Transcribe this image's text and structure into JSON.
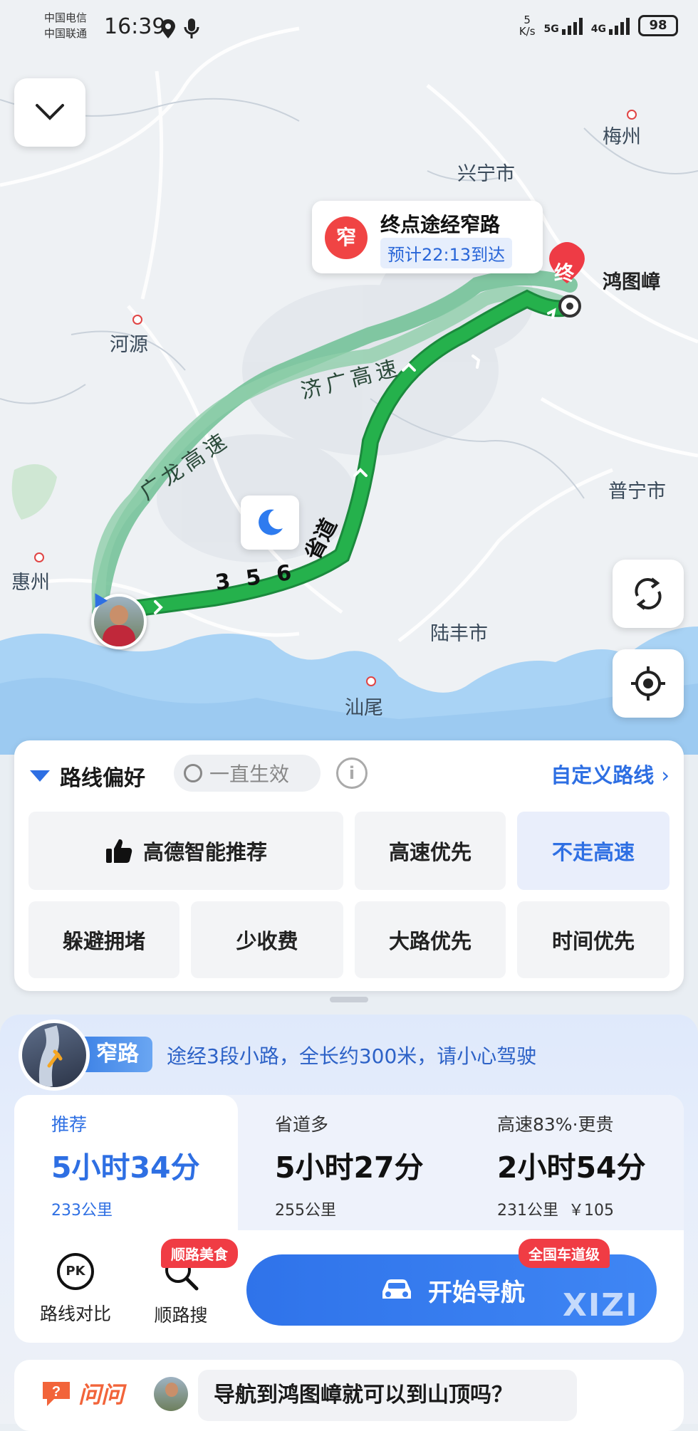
{
  "status_bar": {
    "carrier_1": "中国电信",
    "carrier_2": "中国联通",
    "time": "16:39",
    "speed_value": "5",
    "speed_unit": "K/s",
    "net_1": "5G",
    "net_2": "4G",
    "battery": "98"
  },
  "map": {
    "cities": {
      "meizhou": "梅州",
      "xingning": "兴宁市",
      "heyuan": "河源",
      "huizhou": "惠州",
      "puning": "普宁市",
      "lufeng": "陆丰市",
      "shanwei": "汕尾",
      "destination": "鸿图嶂"
    },
    "roads": {
      "jiguang": "济广高速",
      "guanglong": "广龙高速",
      "provincial_num": "3 5 6",
      "provincial_suffix": "省道"
    },
    "callout": {
      "badge": "窄",
      "title": "终点途经窄路",
      "eta": "预计22:13到达"
    },
    "end_marker": "终"
  },
  "preferences": {
    "title": "路线偏好",
    "always": "一直生效",
    "info_icon": "i",
    "custom": "自定义路线",
    "options": {
      "smart": "高德智能推荐",
      "highway_first": "高速优先",
      "no_highway": "不走高速",
      "avoid_jam": "躲避拥堵",
      "less_toll": "少收费",
      "main_road": "大路优先",
      "time_first": "时间优先"
    },
    "selected": "no_highway"
  },
  "narrow_road": {
    "tag": "窄路",
    "text": "途经3段小路，全长约300米，请小心驾驶"
  },
  "routes": [
    {
      "tag": "推荐",
      "duration": "5小时34分",
      "distance": "233公里",
      "toll": ""
    },
    {
      "tag": "省道多",
      "duration": "5小时27分",
      "distance": "255公里",
      "toll": ""
    },
    {
      "tag": "高速83%·更贵",
      "duration": "2小时54分",
      "distance": "231公里",
      "toll": "￥105"
    }
  ],
  "actions": {
    "compare_icon_text": "PK",
    "compare": "路线对比",
    "along_search": "顺路搜",
    "along_badge": "顺路美食",
    "nav_button": "开始导航",
    "nav_badge": "全国车道级"
  },
  "ask": {
    "label": "问问",
    "question": "导航到鸿图嶂就可以到山顶吗？"
  },
  "watermark": "XIZI"
}
